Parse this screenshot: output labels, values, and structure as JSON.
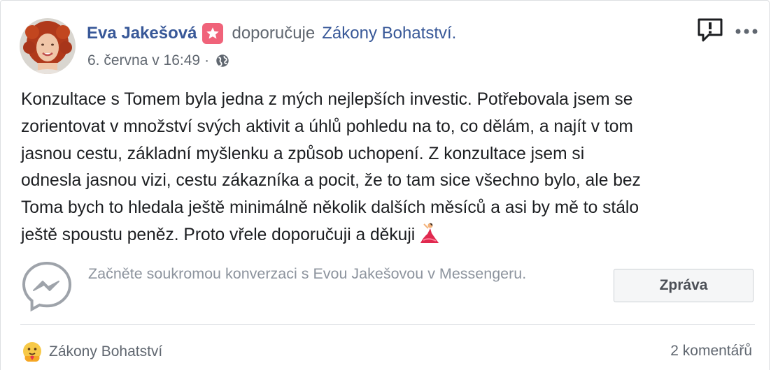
{
  "post": {
    "author": "Eva Jakešová",
    "action": "doporučuje",
    "page_name": "Zákony Bohatství.",
    "timestamp": "6. června v 16:49",
    "separator": "·",
    "privacy_icon": "globe-icon",
    "badge_icon": "star-badge-icon",
    "body_lines": [
      "Konzultace s Tomem byla jedna z mých nejlepších investic. Potřebovala jsem se",
      "zorientovat v množství svých aktivit a úhlů pohledu na to, co dělám, a najít v tom",
      "jasnou cestu, základní myšlenku a způsob uchopení. Z konzultace jsem si",
      "odnesla jasnou vizi, cestu zákazníka a pocit, že to tam sice všechno bylo, ale bez",
      "Toma bych to hledala ještě minimálně několik dalších měsíců a asi by mě to stálo",
      "ještě spoustu peněz. Proto vřele doporučuji a děkuji"
    ],
    "body_emoji": "dancer-emoji"
  },
  "messenger": {
    "prompt": "Začněte soukromou konverzaci s Evou Jakešovou v Messengeru.",
    "button_label": "Zpráva",
    "icon": "messenger-icon"
  },
  "footer": {
    "reaction_icon": "care-reaction-icon",
    "page_name": "Zákony Bohatství",
    "comments": "2 komentářů"
  },
  "colors": {
    "link": "#385898",
    "secondary_text": "#606770",
    "badge": "#f0637a"
  }
}
